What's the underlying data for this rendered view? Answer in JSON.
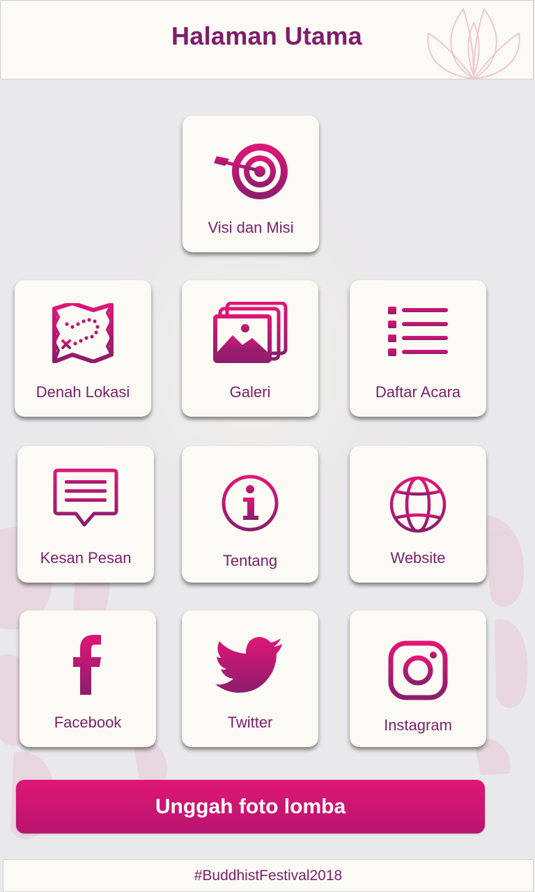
{
  "header": {
    "title": "Halaman Utama"
  },
  "menu": {
    "visi": {
      "label": "Visi dan Misi",
      "icon": "target-icon"
    },
    "denah": {
      "label": "Denah Lokasi",
      "icon": "map-icon"
    },
    "galeri": {
      "label": "Galeri",
      "icon": "gallery-icon"
    },
    "acara": {
      "label": "Daftar Acara",
      "icon": "list-icon"
    },
    "kesan": {
      "label": "Kesan Pesan",
      "icon": "message-icon"
    },
    "tentang": {
      "label": "Tentang",
      "icon": "info-icon"
    },
    "website": {
      "label": "Website",
      "icon": "globe-icon"
    },
    "facebook": {
      "label": "Facebook",
      "icon": "facebook-icon"
    },
    "twitter": {
      "label": "Twitter",
      "icon": "twitter-icon"
    },
    "instagram": {
      "label": "Instagram",
      "icon": "instagram-icon"
    }
  },
  "upload_button": {
    "label": "Unggah foto lomba"
  },
  "footer": {
    "hashtag": "#BuddhistFestival2018"
  },
  "colors": {
    "accent": "#b8156f",
    "accent_light": "#df1676",
    "text": "#7a1f6b",
    "tile": "#fbfaf4"
  }
}
